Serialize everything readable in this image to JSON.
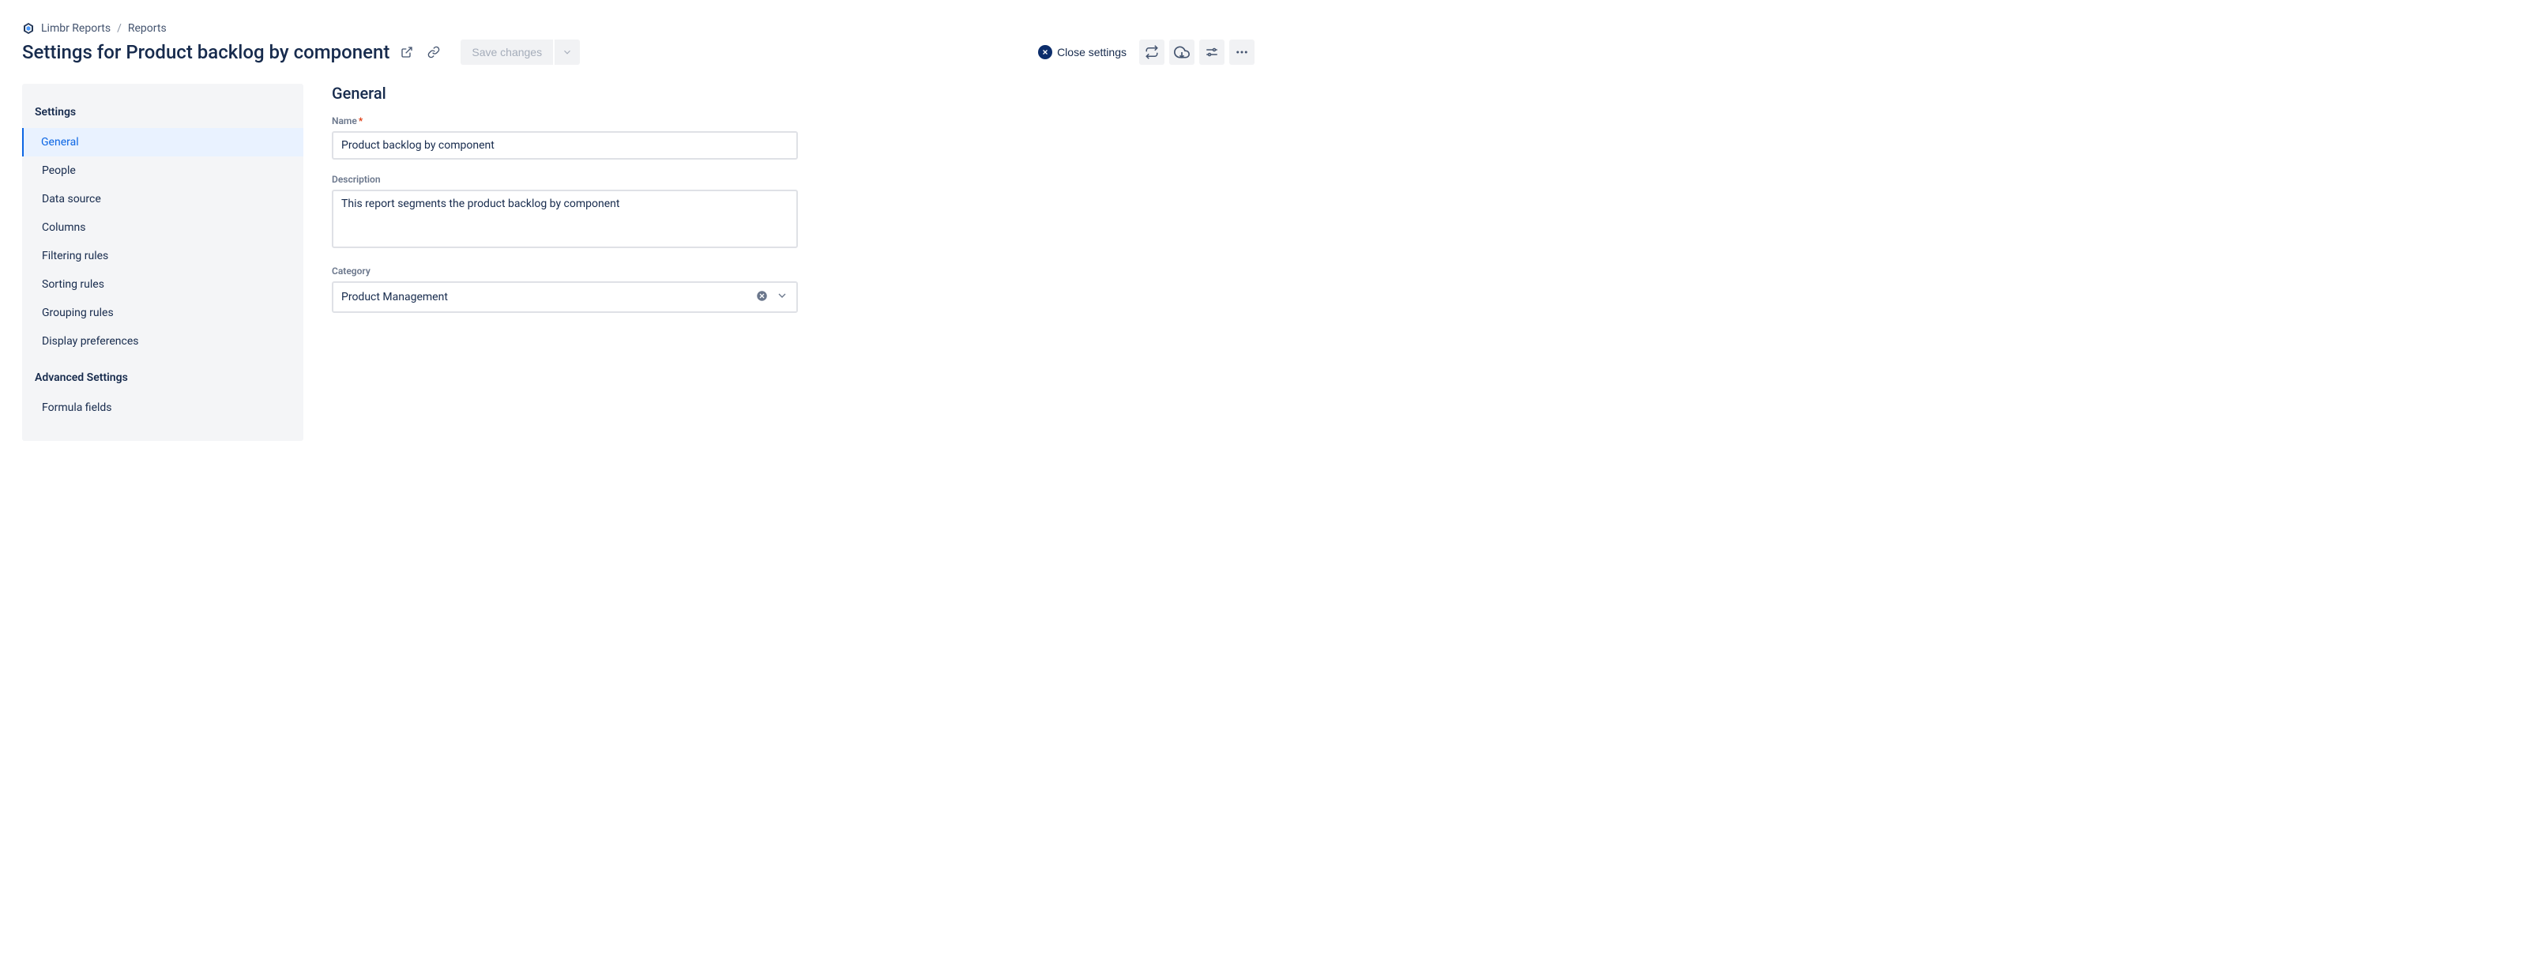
{
  "breadcrumb": {
    "project": "Limbr Reports",
    "section": "Reports"
  },
  "header": {
    "title_prefix": "Settings for ",
    "title_name": "Product backlog by component",
    "save_label": "Save changes",
    "close_label": "Close settings"
  },
  "sidebar": {
    "heading_settings": "Settings",
    "heading_advanced": "Advanced Settings",
    "items": [
      {
        "label": "General",
        "active": true
      },
      {
        "label": "People"
      },
      {
        "label": "Data source"
      },
      {
        "label": "Columns"
      },
      {
        "label": "Filtering rules"
      },
      {
        "label": "Sorting rules"
      },
      {
        "label": "Grouping rules"
      },
      {
        "label": "Display preferences"
      }
    ],
    "advanced_items": [
      {
        "label": "Formula fields"
      }
    ]
  },
  "form": {
    "section_title": "General",
    "name_label": "Name",
    "name_value": "Product backlog by component",
    "description_label": "Description",
    "description_value": "This report segments the product backlog by component",
    "category_label": "Category",
    "category_value": "Product Management"
  }
}
